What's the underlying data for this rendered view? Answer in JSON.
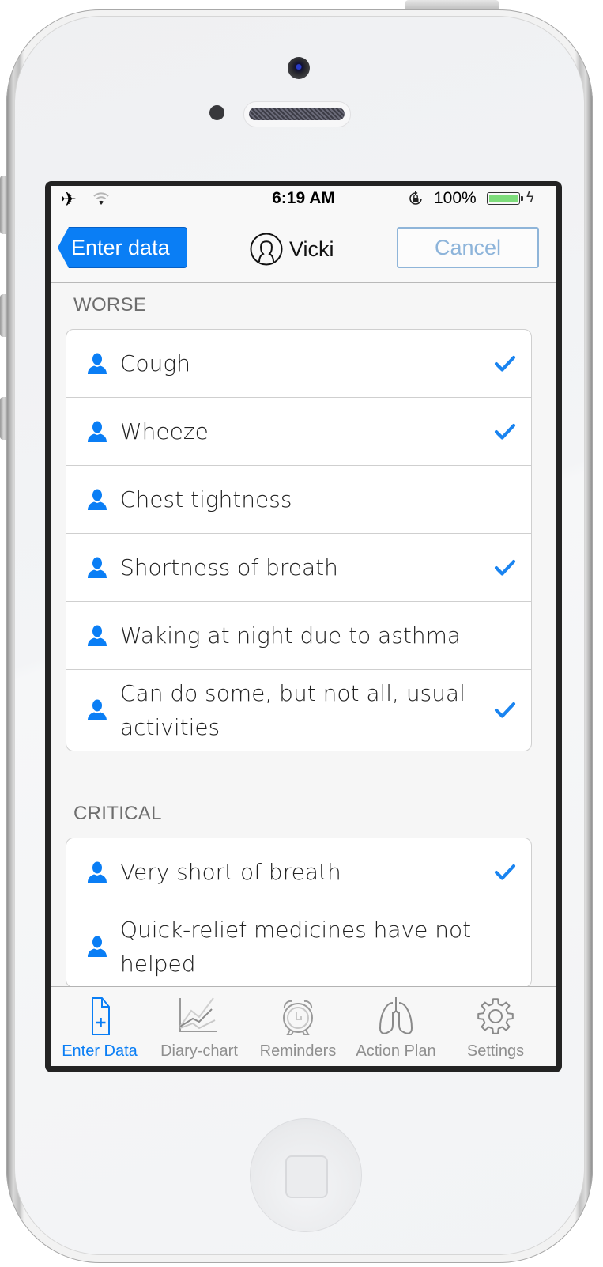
{
  "status_bar": {
    "airplane_icon": "airplane-icon",
    "wifi_icon": "wifi-icon",
    "time": "6:19 AM",
    "rotation_lock_icon": "rotation-lock-icon",
    "battery_percent": "100%",
    "battery_level": 1.0,
    "charging_icon": "bolt-icon"
  },
  "nav": {
    "back_label": "Enter data",
    "title": "Vicki",
    "avatar_icon": "user-circle-icon",
    "cancel_label": "Cancel"
  },
  "colors": {
    "accent": "#0a7ef5",
    "cancel_border": "#8fb5d9",
    "battery_fill": "#7ddc7a"
  },
  "sections": [
    {
      "title": "WORSE",
      "items": [
        {
          "label": "Cough",
          "checked": true,
          "lines": 1
        },
        {
          "label": "Wheeze",
          "checked": true,
          "lines": 1
        },
        {
          "label": "Chest tightness",
          "checked": false,
          "lines": 1
        },
        {
          "label": "Shortness of breath",
          "checked": true,
          "lines": 1
        },
        {
          "label": "Waking at night due to asthma",
          "checked": false,
          "lines": 1
        },
        {
          "label": "Can do some, but not all, usual activities",
          "checked": true,
          "lines": 2
        }
      ]
    },
    {
      "title": "CRITICAL",
      "items": [
        {
          "label": "Very short of breath",
          "checked": true,
          "lines": 1
        },
        {
          "label": "Quick-relief medicines have not helped",
          "checked": false,
          "lines": 2
        }
      ]
    }
  ],
  "tabbar": {
    "tabs": [
      {
        "label": "Enter Data",
        "icon": "document-plus-icon",
        "active": true
      },
      {
        "label": "Diary-chart",
        "icon": "line-chart-icon",
        "active": false
      },
      {
        "label": "Reminders",
        "icon": "alarm-clock-icon",
        "active": false
      },
      {
        "label": "Action Plan",
        "icon": "lungs-icon",
        "active": false
      },
      {
        "label": "Settings",
        "icon": "gear-icon",
        "active": false
      }
    ]
  }
}
